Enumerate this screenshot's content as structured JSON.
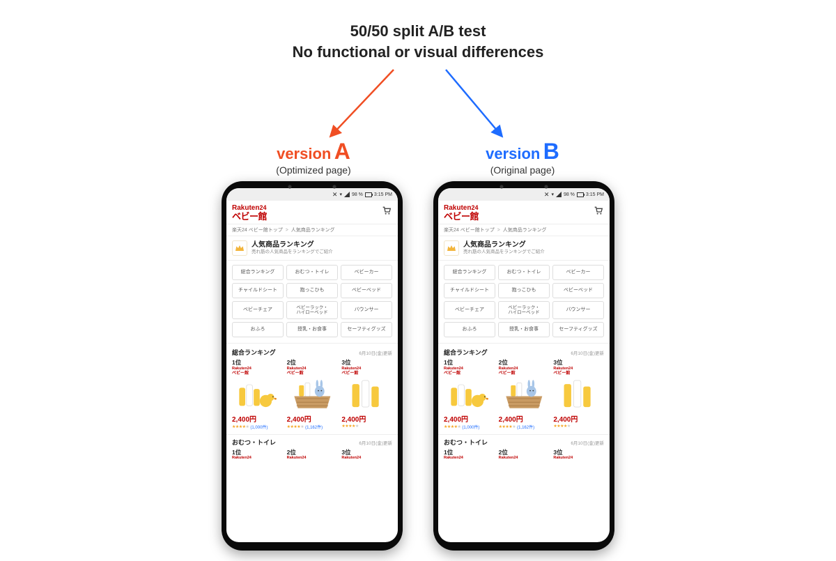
{
  "header": {
    "line1": "50/50 split A/B test",
    "line2": "No functional or visual differences"
  },
  "labels": {
    "a_prefix": "version",
    "a_letter": "A",
    "a_caption": "(Optimized page)",
    "b_prefix": "version",
    "b_letter": "B",
    "b_caption": "(Original page)"
  },
  "status": {
    "battery": "98 %",
    "time": "3:15 PM"
  },
  "brand": {
    "top": "Rakuten",
    "top_suffix": "24",
    "sub": "ベビー館"
  },
  "breadcrumb": {
    "seg1": "楽天24 ベビー館トップ",
    "sep": ">",
    "seg2": "人気商品ランキング"
  },
  "title": {
    "main": "人気商品ランキング",
    "sub": "売れ筋の人気商品をランキングでご紹介"
  },
  "chips": [
    "総合ランキング",
    "おむつ・トイレ",
    "ベビーカー",
    "チャイルドシート",
    "抱っこひも",
    "ベビーベッド",
    "ベビーチェア",
    "ベビーラック・\nハイローベッド",
    "バウンサー",
    "おふろ",
    "授乳・お食事",
    "セーフティグッズ"
  ],
  "section1": {
    "heading": "総合ランキング",
    "date": "6月10日(金)更新"
  },
  "products": [
    {
      "rank": "1位",
      "price": "2,400円",
      "reviews": "(1,000件)",
      "stars": 4
    },
    {
      "rank": "2位",
      "price": "2,400円",
      "reviews": "(1,162件)",
      "stars": 4
    },
    {
      "rank": "3位",
      "price": "2,400円",
      "reviews": "",
      "stars": 4
    }
  ],
  "section2": {
    "heading": "おむつ・トイレ",
    "date": "6月10日(金)更新"
  },
  "ranks2": [
    "1位",
    "2位",
    "3位"
  ],
  "mini_brand": "Rakuten24"
}
